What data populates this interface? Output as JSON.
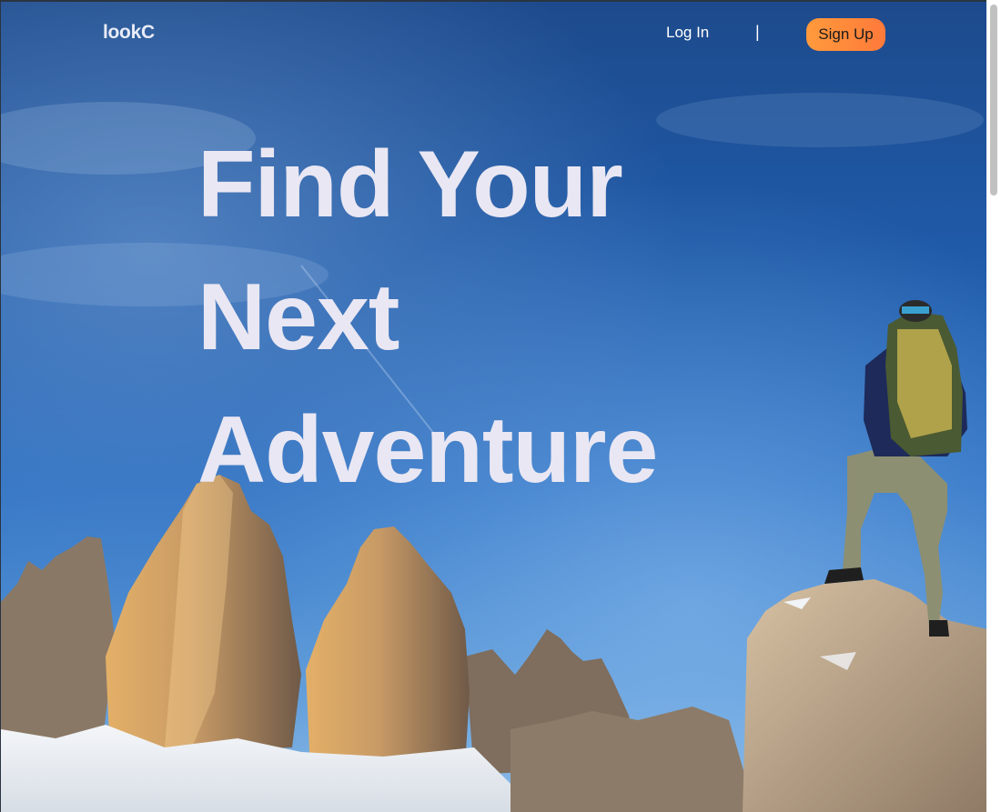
{
  "brand": {
    "logo_text": "lookC"
  },
  "nav": {
    "login_label": "Log In",
    "divider": "|",
    "signup_label": "Sign Up"
  },
  "hero": {
    "headline_lines": [
      "Find Your",
      "Next",
      "Adventure"
    ],
    "background_description_icon": "mountain-hiker-photo"
  },
  "colors": {
    "accent_signup": "#ff8a3c",
    "headline_text": "#e9e7f3",
    "sky_top": "#1d4a8c",
    "sky_bottom": "#8cbbe6"
  }
}
